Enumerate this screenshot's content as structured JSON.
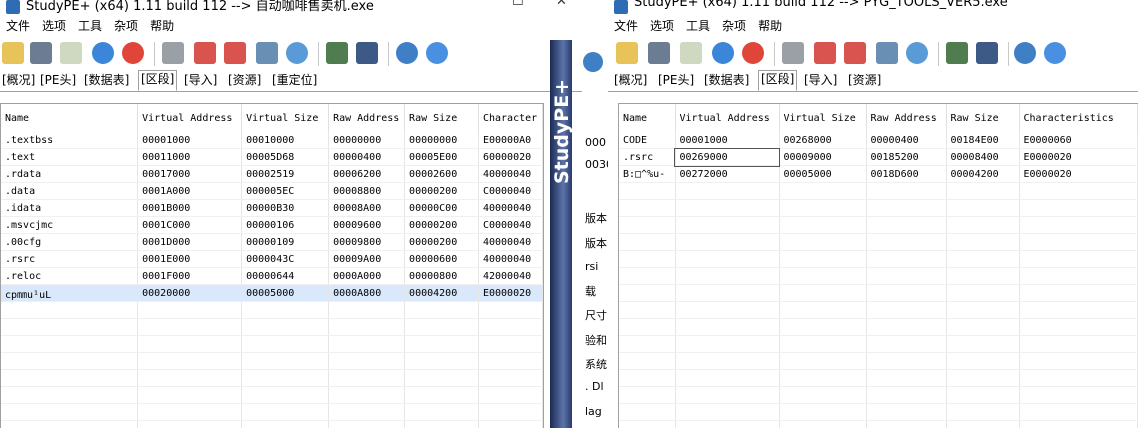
{
  "window1": {
    "title": "StudyPE+ (x64) 1.11 build 112 --> 自动咖啡售卖机.exe",
    "menu": [
      "文件",
      "选项",
      "工具",
      "杂项",
      "帮助"
    ],
    "tabs": [
      "[概况]",
      "[PE头]",
      "[数据表]",
      "[区段]",
      "[导入]",
      "[资源]",
      "[重定位]"
    ],
    "active_tab": 3,
    "columns": [
      "Name",
      "Virtual Address",
      "Virtual Size",
      "Raw Address",
      "Raw Size",
      "Character"
    ],
    "rows": [
      [
        ".textbss",
        "00001000",
        "00010000",
        "00000000",
        "00000000",
        "E00000A0"
      ],
      [
        ".text",
        "00011000",
        "00005D68",
        "00000400",
        "00005E00",
        "60000020"
      ],
      [
        ".rdata",
        "00017000",
        "00002519",
        "00006200",
        "00002600",
        "40000040"
      ],
      [
        ".data",
        "0001A000",
        "000005EC",
        "00008800",
        "00000200",
        "C0000040"
      ],
      [
        ".idata",
        "0001B000",
        "00000B30",
        "00008A00",
        "00000C00",
        "40000040"
      ],
      [
        ".msvcjmc",
        "0001C000",
        "00000106",
        "00009600",
        "00000200",
        "C0000040"
      ],
      [
        ".00cfg",
        "0001D000",
        "00000109",
        "00009800",
        "00000200",
        "40000040"
      ],
      [
        ".rsrc",
        "0001E000",
        "0000043C",
        "00009A00",
        "00000600",
        "40000040"
      ],
      [
        ".reloc",
        "0001F000",
        "00000644",
        "0000A000",
        "00000800",
        "42000040"
      ],
      [
        "cp㎜u¹uL",
        "00020000",
        "00005000",
        "0000A800",
        "00004200",
        "E0000020"
      ]
    ],
    "selected_row": 9,
    "banner": "StudyPE+"
  },
  "gap_texts": [
    "版本",
    "版本",
    "rsi",
    "载",
    "尺寸",
    "验和",
    "系统",
    ". Dl",
    "lag"
  ],
  "gap_top_cells": [
    "000",
    "0030"
  ],
  "window2": {
    "title": "StudyPE+ (x64) 1.11 build 112 --> PYG_TOOLS_VER5.exe",
    "menu": [
      "文件",
      "选项",
      "工具",
      "杂项",
      "帮助"
    ],
    "tabs": [
      "[概况]",
      "[PE头]",
      "[数据表]",
      "[区段]",
      "[导入]",
      "[资源]"
    ],
    "active_tab": 3,
    "columns": [
      "Name",
      "Virtual Address",
      "Virtual Size",
      "Raw Address",
      "Raw Size",
      "Characteristics"
    ],
    "rows": [
      [
        "CODE",
        "00001000",
        "00268000",
        "00000400",
        "00184E00",
        "E0000060"
      ],
      [
        ".rsrc",
        "00269000",
        "00009000",
        "00185200",
        "00008400",
        "E0000020"
      ],
      [
        "B:□^%u-",
        "00272000",
        "00005000",
        "0018D600",
        "00004200",
        "E0000020"
      ]
    ],
    "editing_cell": [
      1,
      1
    ]
  },
  "colors": {
    "selection": "#d9e8fb",
    "banner": "#2a3a6c"
  }
}
